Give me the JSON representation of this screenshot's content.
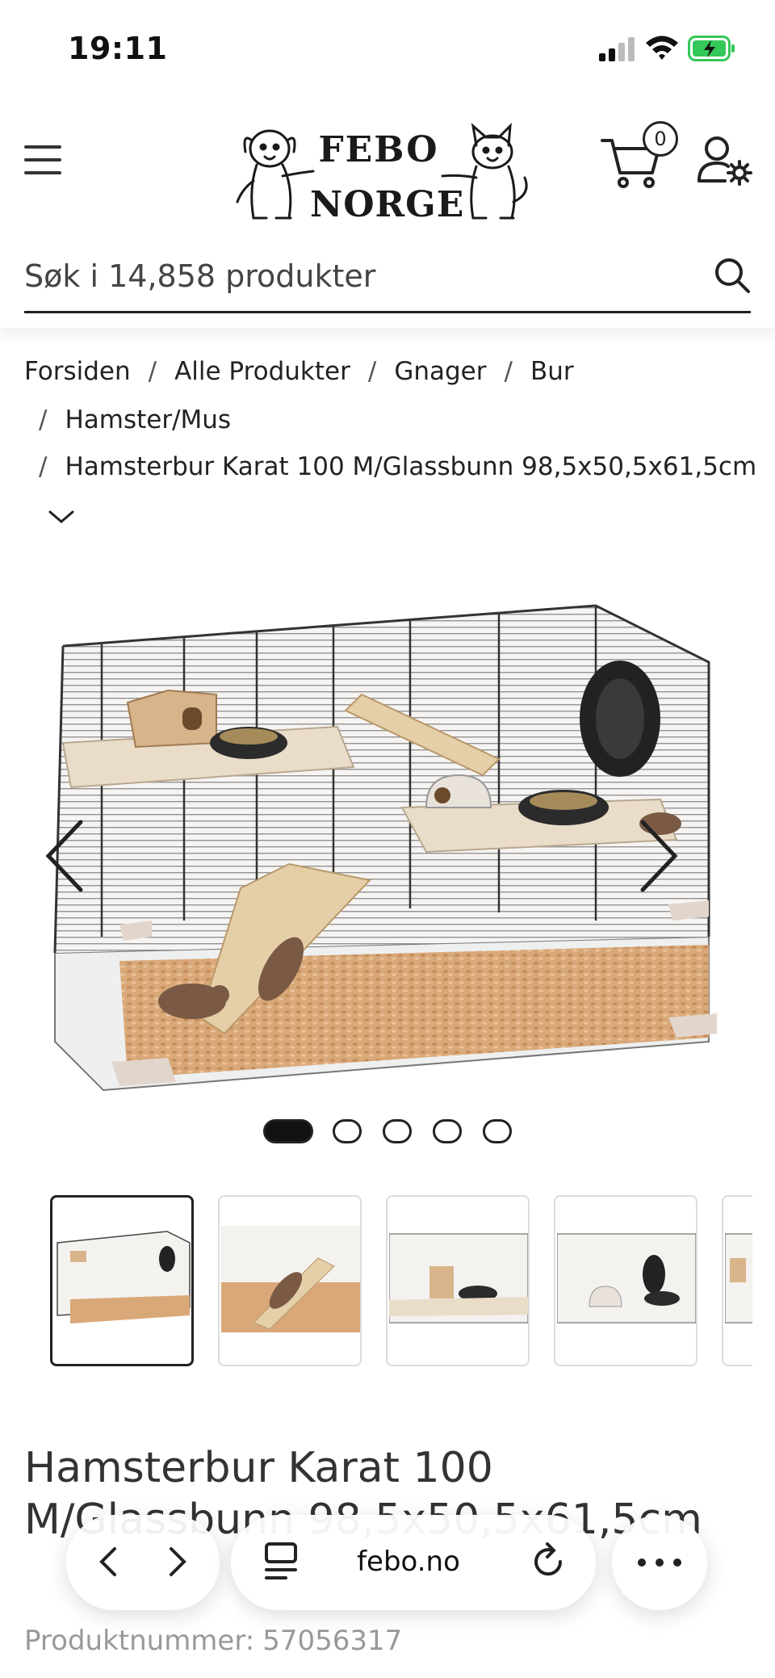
{
  "status_bar": {
    "time": "19:11"
  },
  "header": {
    "logo_line1": "FEBO",
    "logo_line2": "NORGE",
    "cart_count": "0",
    "search_placeholder": "Søk i 14,858 produkter"
  },
  "breadcrumb": {
    "items": [
      "Forsiden",
      "Alle Produkter",
      "Gnager",
      "Bur",
      "Hamster/Mus",
      "Hamsterbur Karat 100 M/Glassbunn 98,5x50,5x61,5cm"
    ],
    "separator": "/"
  },
  "gallery": {
    "image_count": 5,
    "active_index": 0
  },
  "product": {
    "title": "Hamsterbur Karat 100 M/Glassbunn 98,5x50,5x61,5cm",
    "number_label": "Produktnummer:",
    "number_value": "57056317"
  },
  "browser": {
    "url": "febo.no"
  },
  "icons": {
    "menu": "hamburger-icon",
    "cart": "cart-icon",
    "account": "user-settings-icon",
    "search": "search-icon",
    "carousel_prev": "chevron-left-icon",
    "carousel_next": "chevron-right-icon",
    "browser_back": "back-icon",
    "browser_forward": "forward-icon",
    "reader": "reader-icon",
    "reload": "reload-icon",
    "more": "more-icon"
  },
  "colors": {
    "text": "#222222",
    "muted": "#999999",
    "battery_green": "#34c759"
  }
}
